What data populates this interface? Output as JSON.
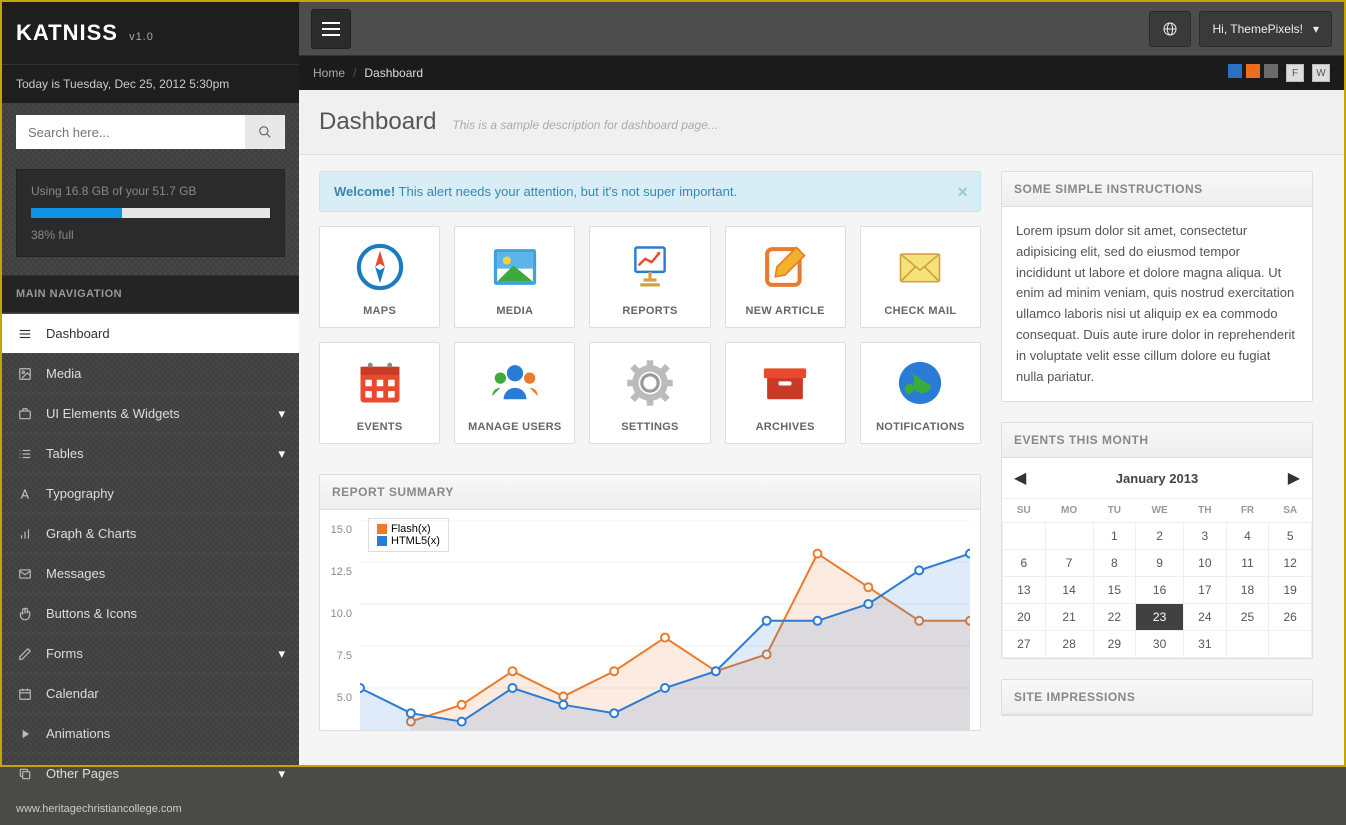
{
  "brand": {
    "name": "KATNISS",
    "version": "v1.0"
  },
  "datebar": "Today is Tuesday, Dec 25, 2012 5:30pm",
  "search": {
    "placeholder": "Search here..."
  },
  "storage": {
    "line": "Using 16.8 GB of your 51.7 GB",
    "percent_label": "38% full",
    "percent": 38
  },
  "nav": {
    "header": "MAIN NAVIGATION",
    "items": [
      {
        "label": "Dashboard",
        "icon": "dashboard",
        "active": true,
        "sub": false
      },
      {
        "label": "Media",
        "icon": "image",
        "active": false,
        "sub": false
      },
      {
        "label": "UI Elements & Widgets",
        "icon": "briefcase",
        "active": false,
        "sub": true
      },
      {
        "label": "Tables",
        "icon": "list",
        "active": false,
        "sub": true
      },
      {
        "label": "Typography",
        "icon": "font",
        "active": false,
        "sub": false
      },
      {
        "label": "Graph & Charts",
        "icon": "bar",
        "active": false,
        "sub": false
      },
      {
        "label": "Messages",
        "icon": "mail",
        "active": false,
        "sub": false
      },
      {
        "label": "Buttons & Icons",
        "icon": "hand",
        "active": false,
        "sub": false
      },
      {
        "label": "Forms",
        "icon": "pencil",
        "active": false,
        "sub": true
      },
      {
        "label": "Calendar",
        "icon": "calendar",
        "active": false,
        "sub": false
      },
      {
        "label": "Animations",
        "icon": "play",
        "active": false,
        "sub": false
      },
      {
        "label": "Other Pages",
        "icon": "copy",
        "active": false,
        "sub": true
      }
    ]
  },
  "credit": "www.heritagechristiancollege.com",
  "topbar": {
    "greeting": "Hi, ThemePixels!"
  },
  "breadcrumb": {
    "home": "Home",
    "current": "Dashboard"
  },
  "page": {
    "title": "Dashboard",
    "subtitle": "This is a sample description for dashboard page..."
  },
  "alert": {
    "bold": "Welcome!",
    "text": " This alert needs your attention, but it's not super important."
  },
  "tiles": [
    {
      "label": "MAPS",
      "icon": "compass"
    },
    {
      "label": "MEDIA",
      "icon": "picture"
    },
    {
      "label": "REPORTS",
      "icon": "chart"
    },
    {
      "label": "NEW ARTICLE",
      "icon": "edit"
    },
    {
      "label": "CHECK MAIL",
      "icon": "envelope"
    },
    {
      "label": "EVENTS",
      "icon": "calendar-red"
    },
    {
      "label": "MANAGE USERS",
      "icon": "users"
    },
    {
      "label": "SETTINGS",
      "icon": "gear"
    },
    {
      "label": "ARCHIVES",
      "icon": "archive"
    },
    {
      "label": "NOTIFICATIONS",
      "icon": "globe"
    }
  ],
  "instructions": {
    "title": "SOME SIMPLE INSTRUCTIONS",
    "body": "Lorem ipsum dolor sit amet, consectetur adipisicing elit, sed do eiusmod tempor incididunt ut labore et dolore magna aliqua. Ut enim ad minim veniam, quis nostrud exercitation ullamco laboris nisi ut aliquip ex ea commodo consequat. Duis aute irure dolor in reprehenderit in voluptate velit esse cillum dolore eu fugiat nulla pariatur."
  },
  "report": {
    "title": "REPORT SUMMARY"
  },
  "events": {
    "title": "EVENTS THIS MONTH",
    "month": "January 2013",
    "days": [
      "SU",
      "MO",
      "TU",
      "WE",
      "TH",
      "FR",
      "SA"
    ],
    "today": 23,
    "firstDay": 2,
    "numDays": 31
  },
  "impressions": {
    "title": "SITE IMPRESSIONS"
  },
  "chart_data": {
    "type": "line",
    "x": [
      0,
      1,
      2,
      3,
      4,
      5,
      6,
      7,
      8,
      9,
      10,
      11,
      12
    ],
    "series": [
      {
        "name": "Flash(x)",
        "color": "#e87b2e",
        "values": [
          null,
          3.0,
          4.0,
          6.0,
          4.5,
          6.0,
          8.0,
          6.0,
          7.0,
          13.0,
          11.0,
          9.0,
          9.0
        ]
      },
      {
        "name": "HTML5(x)",
        "color": "#2a7bd6",
        "values": [
          5.0,
          3.5,
          3.0,
          5.0,
          4.0,
          3.5,
          5.0,
          6.0,
          9.0,
          9.0,
          10.0,
          12.0,
          13.0
        ]
      }
    ],
    "ylim": [
      2.5,
      15
    ],
    "yticks": [
      5.0,
      7.5,
      10.0,
      12.5,
      15.0
    ]
  }
}
